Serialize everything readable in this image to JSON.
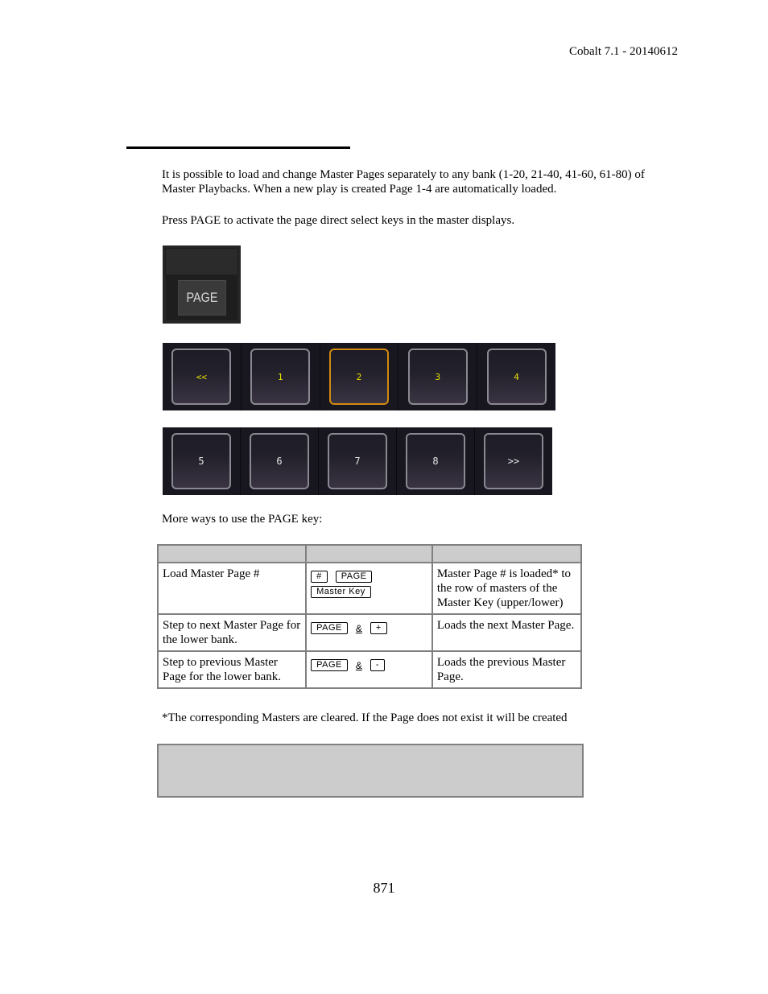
{
  "header": {
    "doc_version": "Cobalt 7.1 - 20140612"
  },
  "body": {
    "intro": "It is possible to load and change Master Pages separately to any bank (1-20, 21-40, 41-60, 61-80) of Master Playbacks. When a new play is created Page 1-4 are automatically loaded.",
    "instruction": "Press PAGE to activate the page direct select keys in the master displays.",
    "page_key_label": "PAGE",
    "key_rows": [
      [
        {
          "label": "<<",
          "selected": false
        },
        {
          "label": "1",
          "selected": false
        },
        {
          "label": "2",
          "selected": true
        },
        {
          "label": "3",
          "selected": false
        },
        {
          "label": "4",
          "selected": false
        }
      ],
      [
        {
          "label": "5",
          "selected": false
        },
        {
          "label": "6",
          "selected": false
        },
        {
          "label": "7",
          "selected": false
        },
        {
          "label": "8",
          "selected": false
        },
        {
          "label": ">>",
          "selected": false
        }
      ]
    ],
    "more_ways": "More ways to use the PAGE key:",
    "table": {
      "headers": [
        "",
        "",
        ""
      ],
      "rows": [
        {
          "action": "Load Master Page #",
          "keys": [
            "#",
            "PAGE"
          ],
          "keys_line2": [
            "Master Key"
          ],
          "result": "Master Page # is loaded* to the row of masters of the Master Key (upper/lower)"
        },
        {
          "action": "Step to next Master Page for the lower bank.",
          "keys": [
            "PAGE",
            "&",
            "+"
          ],
          "result": "Loads the next Master Page."
        },
        {
          "action": "Step to previous Master Page for the lower bank.",
          "keys": [
            "PAGE",
            "&",
            "-"
          ],
          "result": "Loads the previous Master Page."
        }
      ]
    },
    "footnote": "*The corresponding Masters are cleared. If the Page does not exist it will be created",
    "note_box": ""
  },
  "footer": {
    "page_number": "871"
  },
  "colors": {
    "selected_key_border": "#d18a10",
    "page_key_text": "#e8e000",
    "table_header_bg": "#cccccc"
  }
}
